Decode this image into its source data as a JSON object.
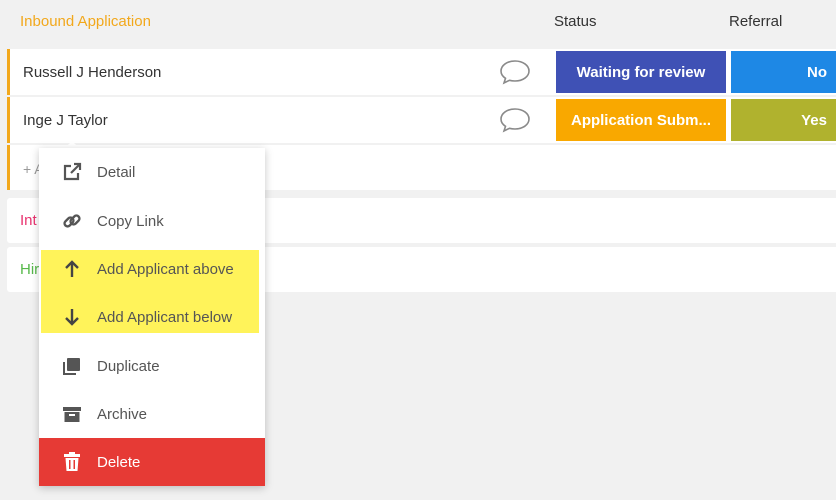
{
  "group": {
    "title": "Inbound Application",
    "columns": {
      "status": "Status",
      "referral": "Referral"
    }
  },
  "rows": [
    {
      "name": "Russell J Henderson",
      "status": "Waiting for review",
      "status_color": "#3f51b5",
      "referral": "No",
      "referral_color": "#1e88e5"
    },
    {
      "name": "Inge J Taylor",
      "status": "Application Subm...",
      "status_color": "#f9a800",
      "referral": "Yes",
      "referral_color": "#b0b22e"
    }
  ],
  "add_row": {
    "text": "+ A"
  },
  "other_groups": [
    {
      "label": "Int",
      "color": "#e8336f"
    },
    {
      "label": "Hir",
      "color": "#57b84a"
    }
  ],
  "menu": {
    "items": [
      {
        "label": "Detail",
        "icon": "external-link-icon"
      },
      {
        "label": "Copy Link",
        "icon": "link-icon"
      },
      {
        "label": "Add Applicant above",
        "icon": "arrow-up-icon"
      },
      {
        "label": "Add Applicant below",
        "icon": "arrow-down-icon"
      },
      {
        "label": "Duplicate",
        "icon": "duplicate-icon"
      },
      {
        "label": "Archive",
        "icon": "archive-icon"
      },
      {
        "label": "Delete",
        "icon": "trash-icon"
      }
    ]
  }
}
